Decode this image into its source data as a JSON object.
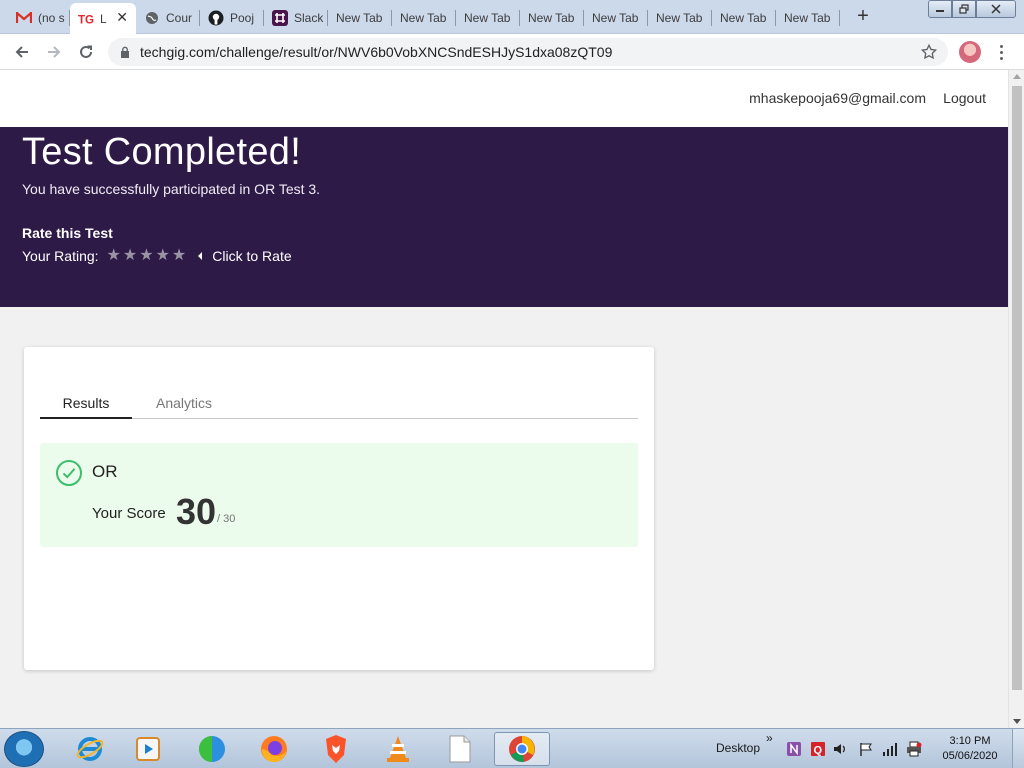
{
  "browser": {
    "tabs": [
      {
        "label": "(no s",
        "icon": "gmail-icon",
        "active": false
      },
      {
        "label": "L",
        "icon": "techgig-icon",
        "active": true
      },
      {
        "label": "Cour",
        "icon": "globe-icon",
        "active": false
      },
      {
        "label": "Pooj",
        "icon": "github-icon",
        "active": false
      },
      {
        "label": "Slack",
        "icon": "slack-icon",
        "active": false
      },
      {
        "label": "New Tab",
        "icon": "",
        "active": false
      },
      {
        "label": "New Tab",
        "icon": "",
        "active": false
      },
      {
        "label": "New Tab",
        "icon": "",
        "active": false
      },
      {
        "label": "New Tab",
        "icon": "",
        "active": false
      },
      {
        "label": "New Tab",
        "icon": "",
        "active": false
      },
      {
        "label": "New Tab",
        "icon": "",
        "active": false
      },
      {
        "label": "New Tab",
        "icon": "",
        "active": false
      },
      {
        "label": "New Tab",
        "icon": "",
        "active": false
      }
    ],
    "new_tab_symbol": "+",
    "url": "techgig.com/challenge/result/or/NWV6b0VobXNCSndESHJyS1dxa08zQT09"
  },
  "header": {
    "email": "mhaskepooja69@gmail.com",
    "logout": "Logout"
  },
  "hero": {
    "title": "Test Completed!",
    "subtitle": "You have successfully participated in OR Test 3.",
    "rate_title": "Rate this Test",
    "rating_label": "Your Rating:",
    "stars": [
      "★",
      "★",
      "★",
      "★",
      "★"
    ],
    "click_to_rate": "Click to Rate"
  },
  "result_card": {
    "tabs": [
      {
        "label": "Results",
        "active": true
      },
      {
        "label": "Analytics",
        "active": false
      }
    ],
    "section_name": "OR",
    "score_label": "Your Score",
    "score": "30",
    "score_max": "/ 30"
  },
  "taskbar": {
    "desktop_label": "Desktop",
    "chevron": "»",
    "time": "3:10 PM",
    "date": "05/06/2020"
  },
  "colors": {
    "hero_bg": "#2e1a47",
    "success_bg": "#ebfbec",
    "success_check": "#3cbf6b"
  }
}
